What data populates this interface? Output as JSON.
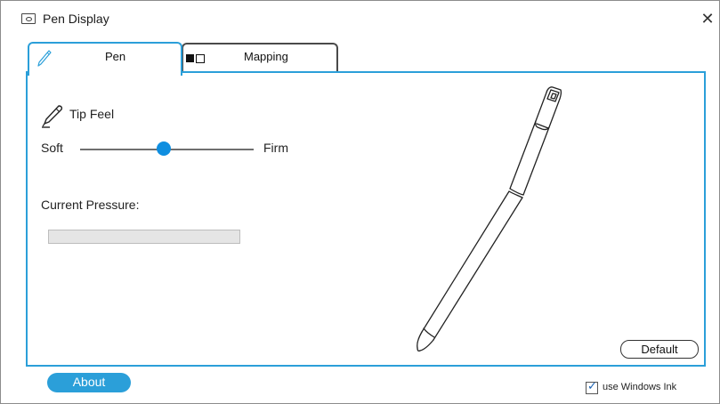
{
  "window": {
    "title": "Pen Display",
    "close_glyph": "✕",
    "app_icon": "display-icon"
  },
  "tabs": [
    {
      "label": "Pen",
      "icon": "pen-icon",
      "selected": true
    },
    {
      "label": "Mapping",
      "icon": "screen-mapping-icon",
      "selected": false
    }
  ],
  "pen_tab": {
    "tip_feel_label": "Tip Feel",
    "tip_feel_icon": "pen-nib-icon",
    "slider": {
      "min_label": "Soft",
      "max_label": "Firm",
      "value": 0.48
    },
    "current_pressure_label": "Current Pressure:",
    "current_pressure_value": 0,
    "pen_illustration": "stylus-illustration",
    "default_button": "Default"
  },
  "footer": {
    "about_button": "About",
    "windows_ink": {
      "label": "use Windows Ink",
      "checked": true,
      "check_glyph": "✓"
    }
  },
  "colors": {
    "accent": "#2b9fd9",
    "slider_thumb": "#0f8ee0",
    "tab_border": "#4a4a4a",
    "pressure_track": "#e5e5e5"
  }
}
